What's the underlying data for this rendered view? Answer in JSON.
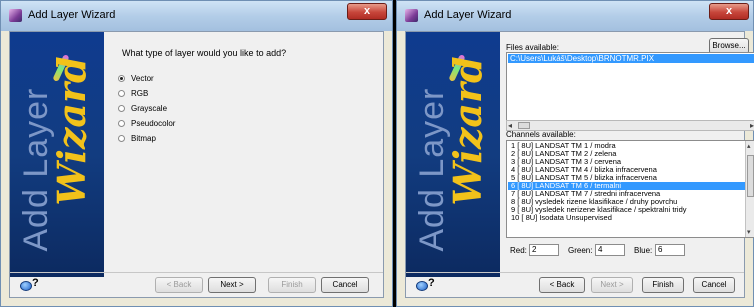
{
  "left_dialog": {
    "title": "Add Layer Wizard",
    "close_label": "x",
    "side_panel": {
      "text_add": "Add Layer",
      "text_wizard": "Wizard"
    },
    "question": "What type of layer would you like to add?",
    "options": [
      {
        "label": "Vector",
        "checked": true
      },
      {
        "label": "RGB",
        "checked": false
      },
      {
        "label": "Grayscale",
        "checked": false
      },
      {
        "label": "Pseudocolor",
        "checked": false
      },
      {
        "label": "Bitmap",
        "checked": false
      }
    ],
    "help_label": "?",
    "buttons": {
      "back": "< Back",
      "next": "Next >",
      "finish": "Finish",
      "cancel": "Cancel"
    }
  },
  "right_dialog": {
    "title": "Add Layer Wizard",
    "close_label": "x",
    "side_panel": {
      "text_add": "Add Layer",
      "text_wizard": "Wizard"
    },
    "files_label": "Files available:",
    "browse_label": "Browse...",
    "files": [
      "C:\\Users\\Lukáš\\Desktop\\BRNOTMR.PIX"
    ],
    "channels_label": "Channels available:",
    "channels": [
      "1 [ 8U] LANDSAT TM 1 / modra",
      "2 [ 8U] LANDSAT TM 2 / zelena",
      "3 [ 8U] LANDSAT TM 3 / cervena",
      "4 [ 8U] LANDSAT TM 4 / blizka infracervena",
      "5 [ 8U] LANDSAT TM 5 / blizka infracervena",
      "6 [ 8U] LANDSAT TM 6 / termalni",
      "7 [ 8U] LANDSAT TM 7 / stredni infracervena",
      "8 [ 8U] vysledek rizene klasifikace / druhy povrchu",
      "9 [ 8U] vysledek nerizene klasifikace / spektralni tridy",
      "10 [ 8U] Isodata Unsupervised"
    ],
    "selected_channel_index": 5,
    "red_label": "Red:",
    "red_value": "2",
    "green_label": "Green:",
    "green_value": "4",
    "blue_label": "Blue:",
    "blue_value": "6",
    "help_label": "?",
    "buttons": {
      "back": "< Back",
      "next": "Next >",
      "finish": "Finish",
      "cancel": "Cancel"
    }
  }
}
